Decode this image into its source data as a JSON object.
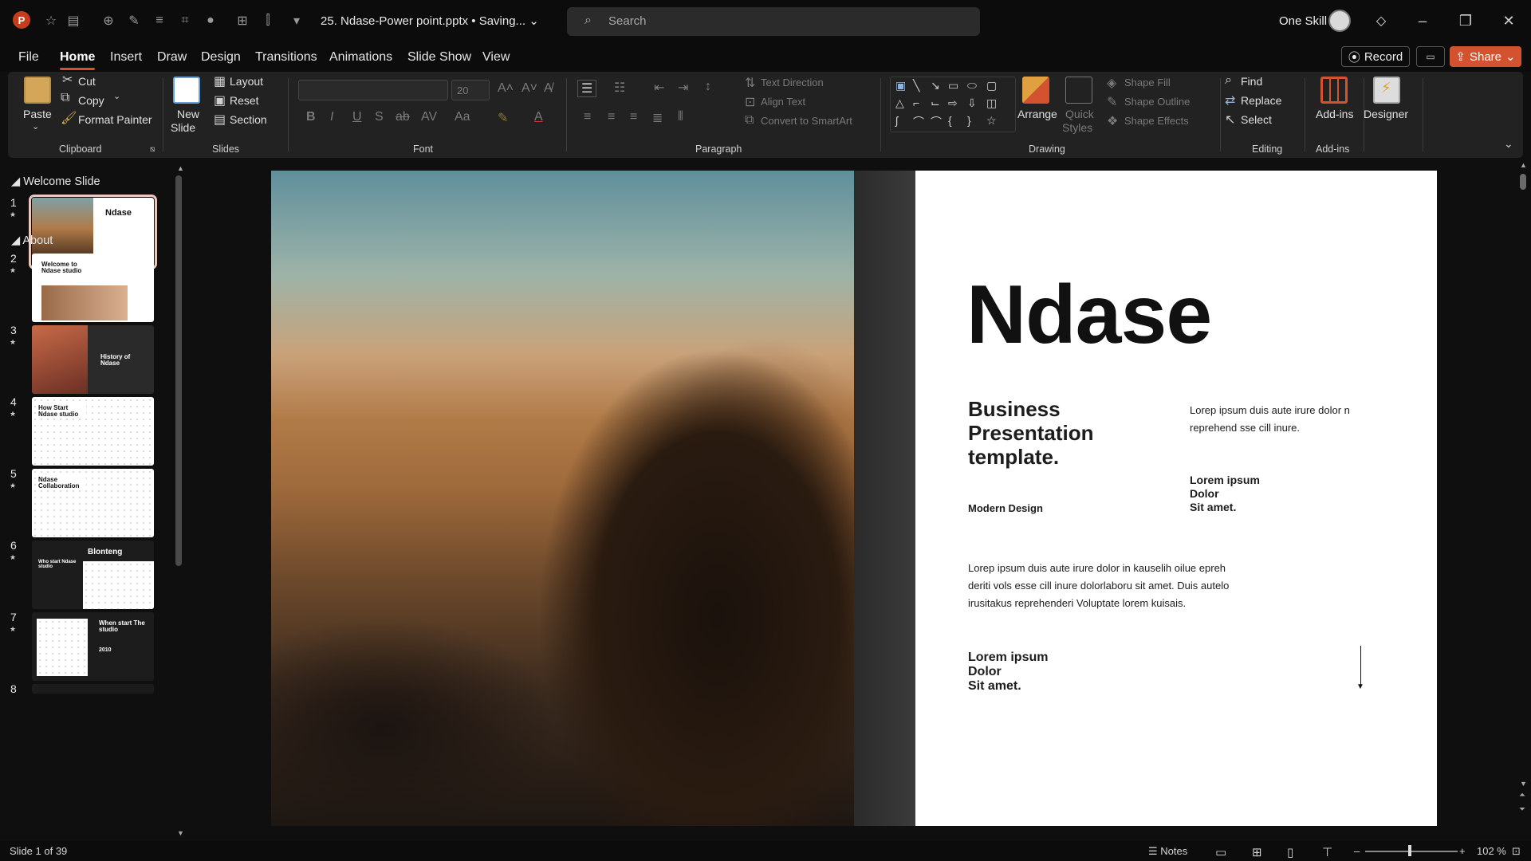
{
  "titlebar": {
    "app_icon_letter": "P",
    "document_title": "25. Ndase-Power point.pptx • Saving...",
    "search_placeholder": "Search",
    "user_name": "One Skill"
  },
  "menu": {
    "tabs": [
      "File",
      "Home",
      "Insert",
      "Draw",
      "Design",
      "Transitions",
      "Animations",
      "Slide Show",
      "View"
    ],
    "active": "Home",
    "record_label": "Record",
    "share_label": "Share"
  },
  "ribbon": {
    "clipboard": {
      "paste": "Paste",
      "cut": "Cut",
      "copy": "Copy",
      "format_painter": "Format Painter",
      "label": "Clipboard"
    },
    "slides": {
      "new_slide_line1": "New",
      "new_slide_line2": "Slide",
      "layout": "Layout",
      "reset": "Reset",
      "section": "Section",
      "label": "Slides"
    },
    "font": {
      "font_size": "20",
      "label": "Font"
    },
    "paragraph": {
      "text_direction": "Text Direction",
      "align_text": "Align Text",
      "convert_smartart": "Convert to SmartArt",
      "label": "Paragraph"
    },
    "drawing": {
      "arrange": "Arrange",
      "quick_styles_line1": "Quick",
      "quick_styles_line2": "Styles",
      "shape_fill": "Shape Fill",
      "shape_outline": "Shape Outline",
      "shape_effects": "Shape Effects",
      "label": "Drawing"
    },
    "editing": {
      "find": "Find",
      "replace": "Replace",
      "select": "Select",
      "label": "Editing"
    },
    "addins": {
      "addins": "Add-ins",
      "label": "Add-ins",
      "designer": "Designer"
    }
  },
  "slide_pane": {
    "sections": [
      {
        "name": "Welcome Slide"
      },
      {
        "name": "About"
      }
    ],
    "slides": [
      {
        "num": "1",
        "title": "Ndase"
      },
      {
        "num": "2",
        "title": "Welcome to Ndase studio"
      },
      {
        "num": "3",
        "title": "History of Ndase"
      },
      {
        "num": "4",
        "title": "How Start Ndase studio"
      },
      {
        "num": "5",
        "title": "Ndase Collaboration"
      },
      {
        "num": "6",
        "title": "Blonteng",
        "subtitle": "Who start Ndase studio"
      },
      {
        "num": "7",
        "title": "When start The studio",
        "extra": "2010"
      },
      {
        "num": "8",
        "title": ""
      }
    ]
  },
  "slide": {
    "title": "Ndase",
    "subtitle_line1": "Business",
    "subtitle_line2": "Presentation",
    "subtitle_line3": "template.",
    "modern_design": "Modern Design",
    "right_para_line1": "Lorep  ipsum duis aute irure dolor n",
    "right_para_line2": "reprehend sse cill inure.",
    "right_bold_line1": "Lorem ipsum",
    "right_bold_line2": "Dolor",
    "right_bold_line3": "Sit amet.",
    "body_line1": "Lorep  ipsum duis aute irure dolor in kauselih oilue epreh",
    "body_line2": "deriti vols esse cill inure dolorlaboru sit amet. Duis autelo",
    "body_line3": "irusitakus reprehenderi Voluptate lorem kuisais.",
    "bottom_line1": "Lorem ipsum",
    "bottom_line2": "Dolor",
    "bottom_line3": "Sit amet."
  },
  "status": {
    "slide_counter": "Slide 1 of 39",
    "notes": "Notes",
    "zoom": "102 %"
  },
  "colors": {
    "accent": "#d35230",
    "ribbon_bg": "#222222",
    "app_bg": "#0f0f0f"
  }
}
